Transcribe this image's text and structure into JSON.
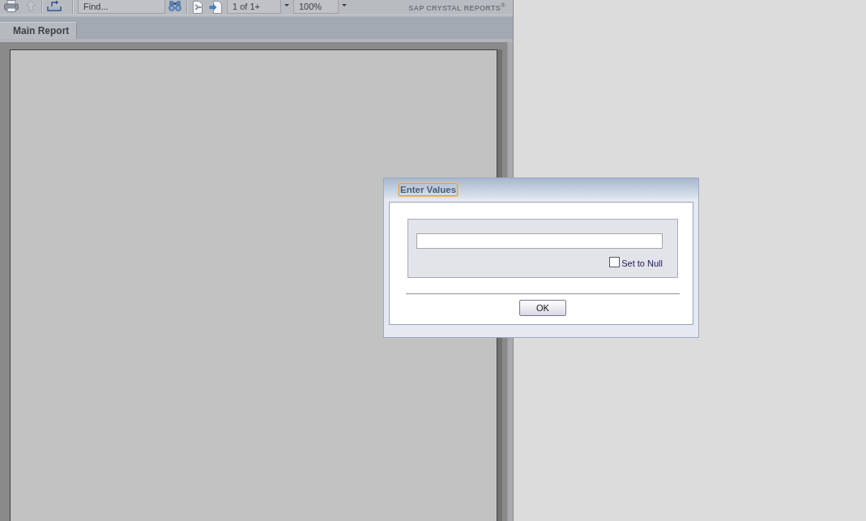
{
  "toolbar": {
    "buttons": [
      {
        "disabled": false
      },
      {
        "disabled": true
      },
      {
        "disabled": false
      }
    ],
    "find": {
      "placeholder": "Find..."
    },
    "nav_buttons": [
      {
        "disabled": true
      },
      {
        "disabled": false
      }
    ],
    "page": {
      "value": "1 of 1+"
    },
    "zoom": {
      "value": "100%"
    },
    "brand": "SAP CRYSTAL REPORTS$^{®}$"
  },
  "tabs": [
    {
      "label": "Main Report",
      "selected": true
    }
  ],
  "dialog": {
    "title": "Enter Values",
    "title_focused": true,
    "set_null": {
      "label": "Set to Null",
      "checked": false
    },
    "button": "OK"
  }
}
